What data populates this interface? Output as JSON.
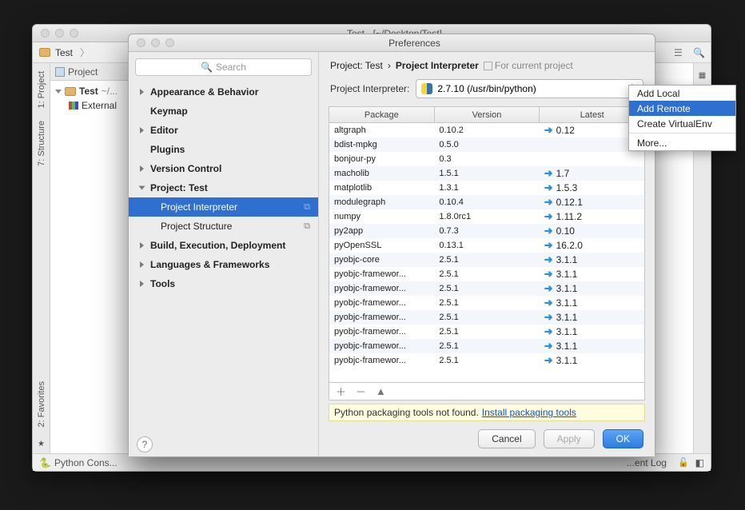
{
  "main": {
    "title": "Test - [~/Desktop/Test]",
    "breadcrumb": "Test",
    "project_pane_title": "Project",
    "tree": {
      "root": "Test",
      "root_path": "~/...",
      "external": "External"
    },
    "side_left": {
      "project": "1: Project",
      "structure": "7: Structure",
      "favorites": "2: Favorites"
    },
    "statusbar": {
      "python_console": "Python Cons...",
      "event_log": "...ent Log"
    }
  },
  "pref": {
    "title": "Preferences",
    "search_placeholder": "Search",
    "tree": {
      "appearance": "Appearance & Behavior",
      "keymap": "Keymap",
      "editor": "Editor",
      "plugins": "Plugins",
      "vcs": "Version Control",
      "project": "Project: Test",
      "project_interpreter": "Project Interpreter",
      "project_structure": "Project Structure",
      "build": "Build, Execution, Deployment",
      "lang": "Languages & Frameworks",
      "tools": "Tools"
    },
    "crumb": {
      "a": "Project: Test",
      "b": "Project Interpreter",
      "badge": "For current project"
    },
    "interp": {
      "label": "Project Interpreter:",
      "value": "2.7.10 (/usr/bin/python)"
    },
    "table": {
      "headers": {
        "package": "Package",
        "version": "Version",
        "latest": "Latest"
      },
      "rows": [
        {
          "p": "altgraph",
          "v": "0.10.2",
          "l": "0.12",
          "up": true
        },
        {
          "p": "bdist-mpkg",
          "v": "0.5.0",
          "l": "",
          "up": false
        },
        {
          "p": "bonjour-py",
          "v": "0.3",
          "l": "",
          "up": false
        },
        {
          "p": "macholib",
          "v": "1.5.1",
          "l": "1.7",
          "up": true
        },
        {
          "p": "matplotlib",
          "v": "1.3.1",
          "l": "1.5.3",
          "up": true
        },
        {
          "p": "modulegraph",
          "v": "0.10.4",
          "l": "0.12.1",
          "up": true
        },
        {
          "p": "numpy",
          "v": "1.8.0rc1",
          "l": "1.11.2",
          "up": true
        },
        {
          "p": "py2app",
          "v": "0.7.3",
          "l": "0.10",
          "up": true
        },
        {
          "p": "pyOpenSSL",
          "v": "0.13.1",
          "l": "16.2.0",
          "up": true
        },
        {
          "p": "pyobjc-core",
          "v": "2.5.1",
          "l": "3.1.1",
          "up": true
        },
        {
          "p": "pyobjc-framewor...",
          "v": "2.5.1",
          "l": "3.1.1",
          "up": true
        },
        {
          "p": "pyobjc-framewor...",
          "v": "2.5.1",
          "l": "3.1.1",
          "up": true
        },
        {
          "p": "pyobjc-framewor...",
          "v": "2.5.1",
          "l": "3.1.1",
          "up": true
        },
        {
          "p": "pyobjc-framewor...",
          "v": "2.5.1",
          "l": "3.1.1",
          "up": true
        },
        {
          "p": "pyobjc-framewor...",
          "v": "2.5.1",
          "l": "3.1.1",
          "up": true
        },
        {
          "p": "pyobjc-framewor...",
          "v": "2.5.1",
          "l": "3.1.1",
          "up": true
        },
        {
          "p": "pyobjc-framewor...",
          "v": "2.5.1",
          "l": "3.1.1",
          "up": true
        }
      ]
    },
    "notice": {
      "text": "Python packaging tools not found.",
      "link": "Install packaging tools"
    },
    "buttons": {
      "cancel": "Cancel",
      "apply": "Apply",
      "ok": "OK"
    }
  },
  "popup": {
    "add_local": "Add Local",
    "add_remote": "Add Remote",
    "create_venv": "Create VirtualEnv",
    "more": "More..."
  }
}
